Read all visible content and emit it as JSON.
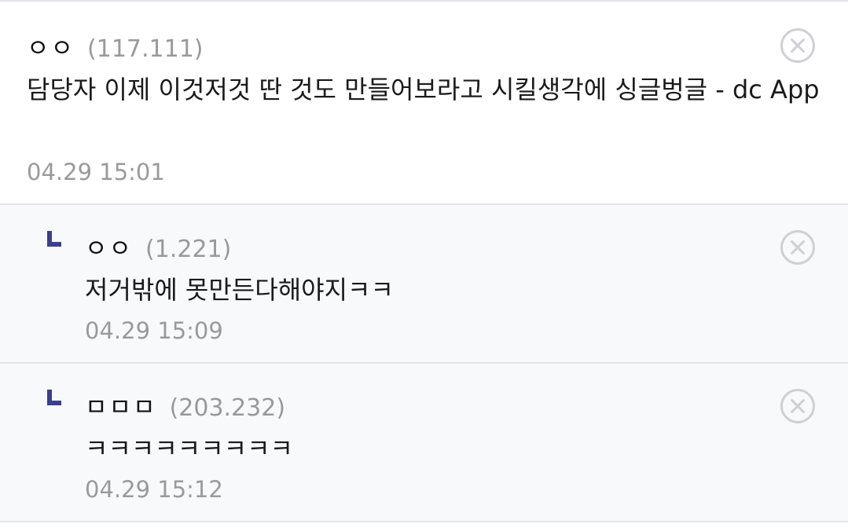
{
  "comments": [
    {
      "nickname": "ㅇㅇ",
      "ip": "(117.111)",
      "text": "담당자 이제 이것저것 딴 것도 만들어보라고 시킬생각에 싱글벙글 - dc App",
      "date": "04.29 15:01",
      "is_reply": false
    },
    {
      "nickname": "ㅇㅇ",
      "ip": "(1.221)",
      "text": "저거밖에 못만든다해야지ㅋㅋ",
      "date": "04.29 15:09",
      "is_reply": true
    },
    {
      "nickname": "ㅁㅁㅁ",
      "ip": "(203.232)",
      "text": "ㅋㅋㅋㅋㅋㅋㅋㅋㅋ",
      "date": "04.29 15:12",
      "is_reply": true
    }
  ],
  "icons": {
    "delete": "close-circle-icon",
    "reply": "reply-corner-icon"
  },
  "colors": {
    "reply_background": "#f8f9fb",
    "reply_marker": "#3b3f8c",
    "meta_text": "#999999",
    "delete_icon": "#cfcfd4"
  }
}
